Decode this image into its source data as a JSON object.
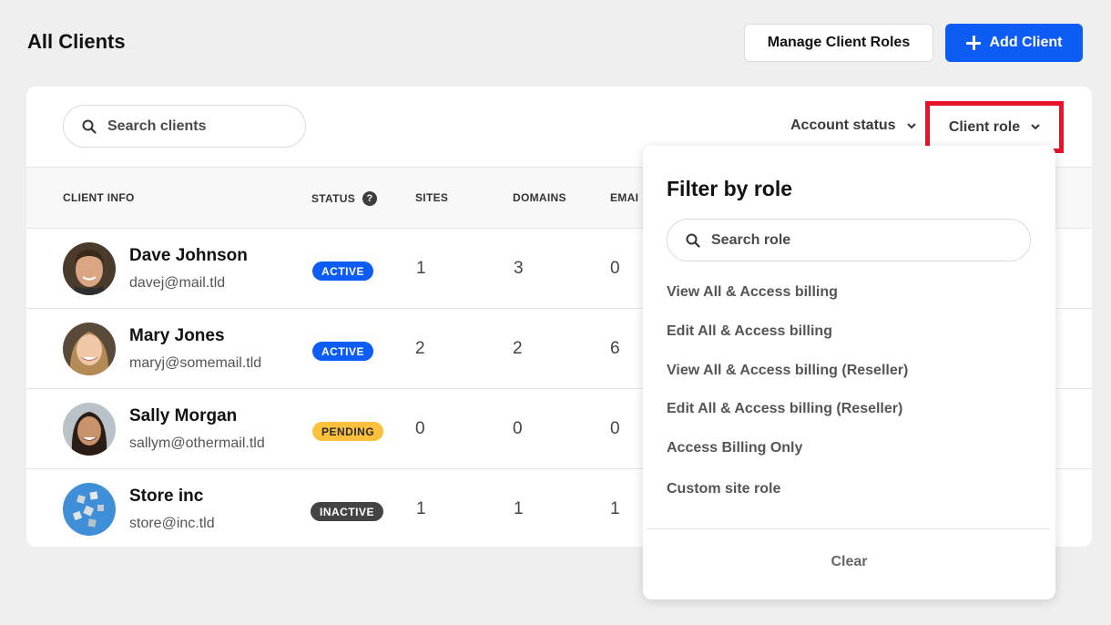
{
  "header": {
    "title": "All Clients",
    "manage_label": "Manage Client Roles",
    "add_label": "Add Client"
  },
  "toolbar": {
    "search_placeholder": "Search clients",
    "account_status_label": "Account status",
    "client_role_label": "Client role"
  },
  "table": {
    "columns": [
      "CLIENT INFO",
      "STATUS",
      "SITES",
      "DOMAINS",
      "EMAI"
    ],
    "rows": [
      {
        "name": "Dave Johnson",
        "email": "davej@mail.tld",
        "status": "ACTIVE",
        "sites": "1",
        "domains": "3",
        "emails": "0"
      },
      {
        "name": "Mary Jones",
        "email": "maryj@somemail.tld",
        "status": "ACTIVE",
        "sites": "2",
        "domains": "2",
        "emails": "6"
      },
      {
        "name": "Sally Morgan",
        "email": "sallym@othermail.tld",
        "status": "PENDING",
        "sites": "0",
        "domains": "0",
        "emails": "0"
      },
      {
        "name": "Store inc",
        "email": "store@inc.tld",
        "status": "INACTIVE",
        "sites": "1",
        "domains": "1",
        "emails": "1"
      }
    ]
  },
  "dropdown": {
    "title": "Filter by role",
    "search_placeholder": "Search role",
    "items": [
      "View All & Access billing",
      "Edit All & Access billing",
      "View All & Access billing (Reseller)",
      "Edit All & Access billing (Reseller)",
      "Access Billing Only",
      "Custom site role"
    ],
    "clear_label": "Clear"
  },
  "colors": {
    "primary": "#0d5cf5",
    "active": "#0d5cf5",
    "pending": "#fcc13c",
    "inactive": "#444444",
    "highlight": "#e8142a"
  }
}
